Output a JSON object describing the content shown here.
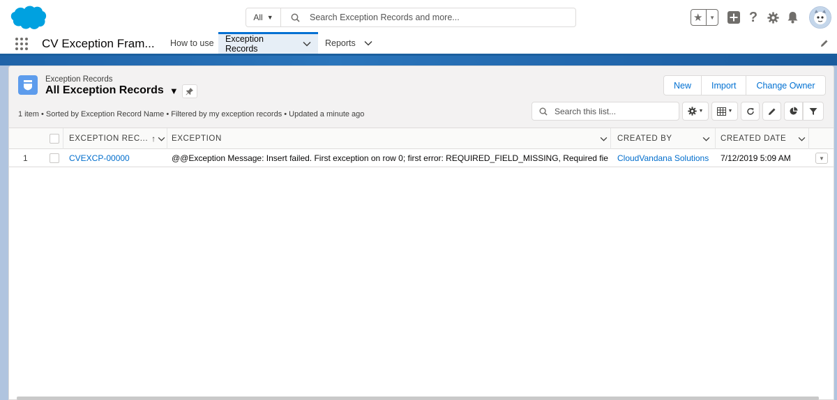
{
  "header": {
    "search_scope": "All",
    "search_placeholder": "Search Exception Records and more..."
  },
  "nav": {
    "app_name": "CV Exception Fram...",
    "tabs": [
      {
        "label": "How to use"
      },
      {
        "label": "Exception Records"
      },
      {
        "label": "Reports"
      }
    ]
  },
  "list": {
    "object_label": "Exception Records",
    "view_name": "All Exception Records",
    "info": "1 item • Sorted by Exception Record Name • Filtered by my exception records • Updated a minute ago",
    "search_placeholder": "Search this list...",
    "buttons": {
      "new": "New",
      "import": "Import",
      "change_owner": "Change Owner"
    },
    "columns": [
      "EXCEPTION REC...",
      "EXCEPTION",
      "CREATED BY",
      "CREATED DATE"
    ],
    "rows": [
      {
        "num": "1",
        "name": "CVEXCP-00000",
        "exception": "@@Exception Message: Insert failed. First exception on row 0; first error: REQUIRED_FIELD_MISSING, Required fiel...",
        "created_by": "CloudVandana Solutions",
        "created_date": "7/12/2019 5:09 AM"
      }
    ]
  },
  "colors": {
    "brand": "#0070d2",
    "link": "#006dcc",
    "salesforce_cloud": "#00a1e0"
  }
}
